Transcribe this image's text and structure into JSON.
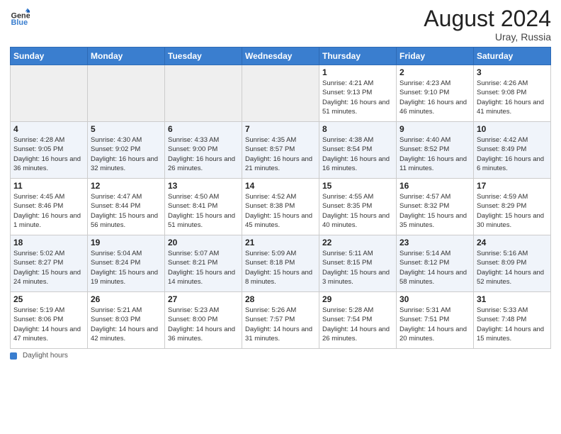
{
  "header": {
    "logo_text_general": "General",
    "logo_text_blue": "Blue",
    "month_year": "August 2024",
    "location": "Uray, Russia"
  },
  "days_of_week": [
    "Sunday",
    "Monday",
    "Tuesday",
    "Wednesday",
    "Thursday",
    "Friday",
    "Saturday"
  ],
  "legend": {
    "label": "Daylight hours"
  },
  "weeks": [
    [
      {
        "day": "",
        "empty": true
      },
      {
        "day": "",
        "empty": true
      },
      {
        "day": "",
        "empty": true
      },
      {
        "day": "",
        "empty": true
      },
      {
        "day": "1",
        "sunrise": "Sunrise: 4:21 AM",
        "sunset": "Sunset: 9:13 PM",
        "daylight": "Daylight: 16 hours and 51 minutes."
      },
      {
        "day": "2",
        "sunrise": "Sunrise: 4:23 AM",
        "sunset": "Sunset: 9:10 PM",
        "daylight": "Daylight: 16 hours and 46 minutes."
      },
      {
        "day": "3",
        "sunrise": "Sunrise: 4:26 AM",
        "sunset": "Sunset: 9:08 PM",
        "daylight": "Daylight: 16 hours and 41 minutes."
      }
    ],
    [
      {
        "day": "4",
        "sunrise": "Sunrise: 4:28 AM",
        "sunset": "Sunset: 9:05 PM",
        "daylight": "Daylight: 16 hours and 36 minutes."
      },
      {
        "day": "5",
        "sunrise": "Sunrise: 4:30 AM",
        "sunset": "Sunset: 9:02 PM",
        "daylight": "Daylight: 16 hours and 32 minutes."
      },
      {
        "day": "6",
        "sunrise": "Sunrise: 4:33 AM",
        "sunset": "Sunset: 9:00 PM",
        "daylight": "Daylight: 16 hours and 26 minutes."
      },
      {
        "day": "7",
        "sunrise": "Sunrise: 4:35 AM",
        "sunset": "Sunset: 8:57 PM",
        "daylight": "Daylight: 16 hours and 21 minutes."
      },
      {
        "day": "8",
        "sunrise": "Sunrise: 4:38 AM",
        "sunset": "Sunset: 8:54 PM",
        "daylight": "Daylight: 16 hours and 16 minutes."
      },
      {
        "day": "9",
        "sunrise": "Sunrise: 4:40 AM",
        "sunset": "Sunset: 8:52 PM",
        "daylight": "Daylight: 16 hours and 11 minutes."
      },
      {
        "day": "10",
        "sunrise": "Sunrise: 4:42 AM",
        "sunset": "Sunset: 8:49 PM",
        "daylight": "Daylight: 16 hours and 6 minutes."
      }
    ],
    [
      {
        "day": "11",
        "sunrise": "Sunrise: 4:45 AM",
        "sunset": "Sunset: 8:46 PM",
        "daylight": "Daylight: 16 hours and 1 minute."
      },
      {
        "day": "12",
        "sunrise": "Sunrise: 4:47 AM",
        "sunset": "Sunset: 8:44 PM",
        "daylight": "Daylight: 15 hours and 56 minutes."
      },
      {
        "day": "13",
        "sunrise": "Sunrise: 4:50 AM",
        "sunset": "Sunset: 8:41 PM",
        "daylight": "Daylight: 15 hours and 51 minutes."
      },
      {
        "day": "14",
        "sunrise": "Sunrise: 4:52 AM",
        "sunset": "Sunset: 8:38 PM",
        "daylight": "Daylight: 15 hours and 45 minutes."
      },
      {
        "day": "15",
        "sunrise": "Sunrise: 4:55 AM",
        "sunset": "Sunset: 8:35 PM",
        "daylight": "Daylight: 15 hours and 40 minutes."
      },
      {
        "day": "16",
        "sunrise": "Sunrise: 4:57 AM",
        "sunset": "Sunset: 8:32 PM",
        "daylight": "Daylight: 15 hours and 35 minutes."
      },
      {
        "day": "17",
        "sunrise": "Sunrise: 4:59 AM",
        "sunset": "Sunset: 8:29 PM",
        "daylight": "Daylight: 15 hours and 30 minutes."
      }
    ],
    [
      {
        "day": "18",
        "sunrise": "Sunrise: 5:02 AM",
        "sunset": "Sunset: 8:27 PM",
        "daylight": "Daylight: 15 hours and 24 minutes."
      },
      {
        "day": "19",
        "sunrise": "Sunrise: 5:04 AM",
        "sunset": "Sunset: 8:24 PM",
        "daylight": "Daylight: 15 hours and 19 minutes."
      },
      {
        "day": "20",
        "sunrise": "Sunrise: 5:07 AM",
        "sunset": "Sunset: 8:21 PM",
        "daylight": "Daylight: 15 hours and 14 minutes."
      },
      {
        "day": "21",
        "sunrise": "Sunrise: 5:09 AM",
        "sunset": "Sunset: 8:18 PM",
        "daylight": "Daylight: 15 hours and 8 minutes."
      },
      {
        "day": "22",
        "sunrise": "Sunrise: 5:11 AM",
        "sunset": "Sunset: 8:15 PM",
        "daylight": "Daylight: 15 hours and 3 minutes."
      },
      {
        "day": "23",
        "sunrise": "Sunrise: 5:14 AM",
        "sunset": "Sunset: 8:12 PM",
        "daylight": "Daylight: 14 hours and 58 minutes."
      },
      {
        "day": "24",
        "sunrise": "Sunrise: 5:16 AM",
        "sunset": "Sunset: 8:09 PM",
        "daylight": "Daylight: 14 hours and 52 minutes."
      }
    ],
    [
      {
        "day": "25",
        "sunrise": "Sunrise: 5:19 AM",
        "sunset": "Sunset: 8:06 PM",
        "daylight": "Daylight: 14 hours and 47 minutes."
      },
      {
        "day": "26",
        "sunrise": "Sunrise: 5:21 AM",
        "sunset": "Sunset: 8:03 PM",
        "daylight": "Daylight: 14 hours and 42 minutes."
      },
      {
        "day": "27",
        "sunrise": "Sunrise: 5:23 AM",
        "sunset": "Sunset: 8:00 PM",
        "daylight": "Daylight: 14 hours and 36 minutes."
      },
      {
        "day": "28",
        "sunrise": "Sunrise: 5:26 AM",
        "sunset": "Sunset: 7:57 PM",
        "daylight": "Daylight: 14 hours and 31 minutes."
      },
      {
        "day": "29",
        "sunrise": "Sunrise: 5:28 AM",
        "sunset": "Sunset: 7:54 PM",
        "daylight": "Daylight: 14 hours and 26 minutes."
      },
      {
        "day": "30",
        "sunrise": "Sunrise: 5:31 AM",
        "sunset": "Sunset: 7:51 PM",
        "daylight": "Daylight: 14 hours and 20 minutes."
      },
      {
        "day": "31",
        "sunrise": "Sunrise: 5:33 AM",
        "sunset": "Sunset: 7:48 PM",
        "daylight": "Daylight: 14 hours and 15 minutes."
      }
    ]
  ]
}
